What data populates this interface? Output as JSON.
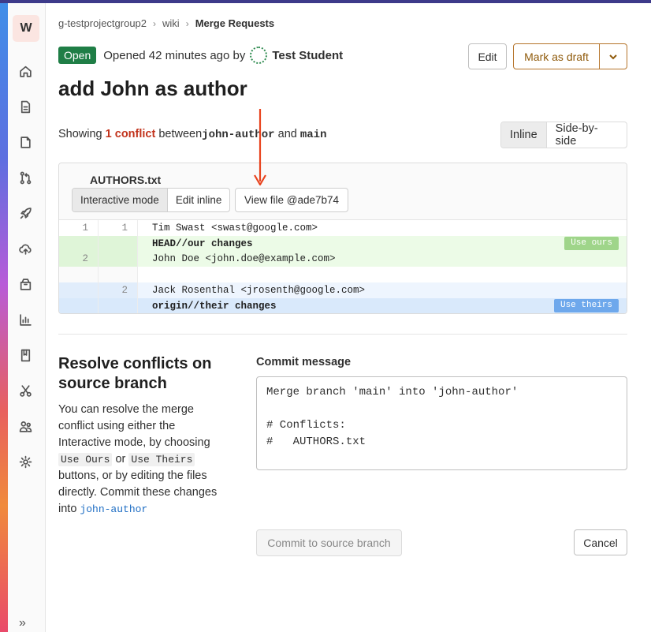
{
  "sidebar": {
    "project_initial": "W",
    "collapse_label": "»",
    "icons": [
      "home-icon",
      "document-icon",
      "issues-icon",
      "merge-request-icon",
      "deploy-rocket-icon",
      "cloud-upload-icon",
      "package-icon",
      "analytics-chart-icon",
      "wiki-book-icon",
      "snippets-scissors-icon",
      "members-icon",
      "settings-gear-icon"
    ]
  },
  "breadcrumb": {
    "items": [
      "g-testprojectgroup2",
      "wiki",
      "Merge Requests"
    ]
  },
  "status": {
    "badge": "Open",
    "opened_text": "Opened 42 minutes ago by",
    "author": "Test Student"
  },
  "header_buttons": {
    "edit": "Edit",
    "mark_draft": "Mark as draft"
  },
  "title": "add John as author",
  "showing": {
    "prefix": "Showing",
    "conflict_count": "1 conflict",
    "between": "between",
    "source": "john-author",
    "and": "and",
    "target": "main"
  },
  "view_toggle": {
    "inline": "Inline",
    "side_by_side": "Side-by-side"
  },
  "file": {
    "name": "AUTHORS.txt",
    "interactive_mode": "Interactive mode",
    "edit_inline": "Edit inline",
    "view_file": "View file @ade7b74",
    "lines": [
      {
        "old": "1",
        "new": "1",
        "text": "Tim Swast <swast@google.com>"
      },
      {
        "old": "",
        "new": "",
        "text": "HEAD//our changes"
      },
      {
        "old": "2",
        "new": "",
        "text": "John Doe <john.doe@example.com>"
      },
      {
        "old": "",
        "new": "",
        "text": ""
      },
      {
        "old": "",
        "new": "2",
        "text": "Jack Rosenthal <jrosenth@google.com>"
      },
      {
        "old": "",
        "new": "",
        "text": "origin//their changes"
      }
    ],
    "use_ours": "Use ours",
    "use_theirs": "Use theirs"
  },
  "resolve": {
    "title": "Resolve conflicts on source branch",
    "text_1": "You can resolve the merge conflict using either the Interactive mode, by choosing",
    "use_ours_code": "Use Ours",
    "or": "or",
    "use_theirs_code": "Use Theirs",
    "text_2": "buttons, or by editing the files directly. Commit these changes into",
    "branch": "john-author"
  },
  "commit": {
    "label": "Commit message",
    "message": "Merge branch 'main' into 'john-author'\n\n# Conflicts:\n#   AUTHORS.txt",
    "commit_button": "Commit to source branch",
    "cancel_button": "Cancel"
  },
  "colors": {
    "open_badge": "#1f7e46",
    "conflict_text": "#c2331c",
    "draft_button": "#8f5a0b",
    "annotation_arrow": "#e8431e"
  }
}
